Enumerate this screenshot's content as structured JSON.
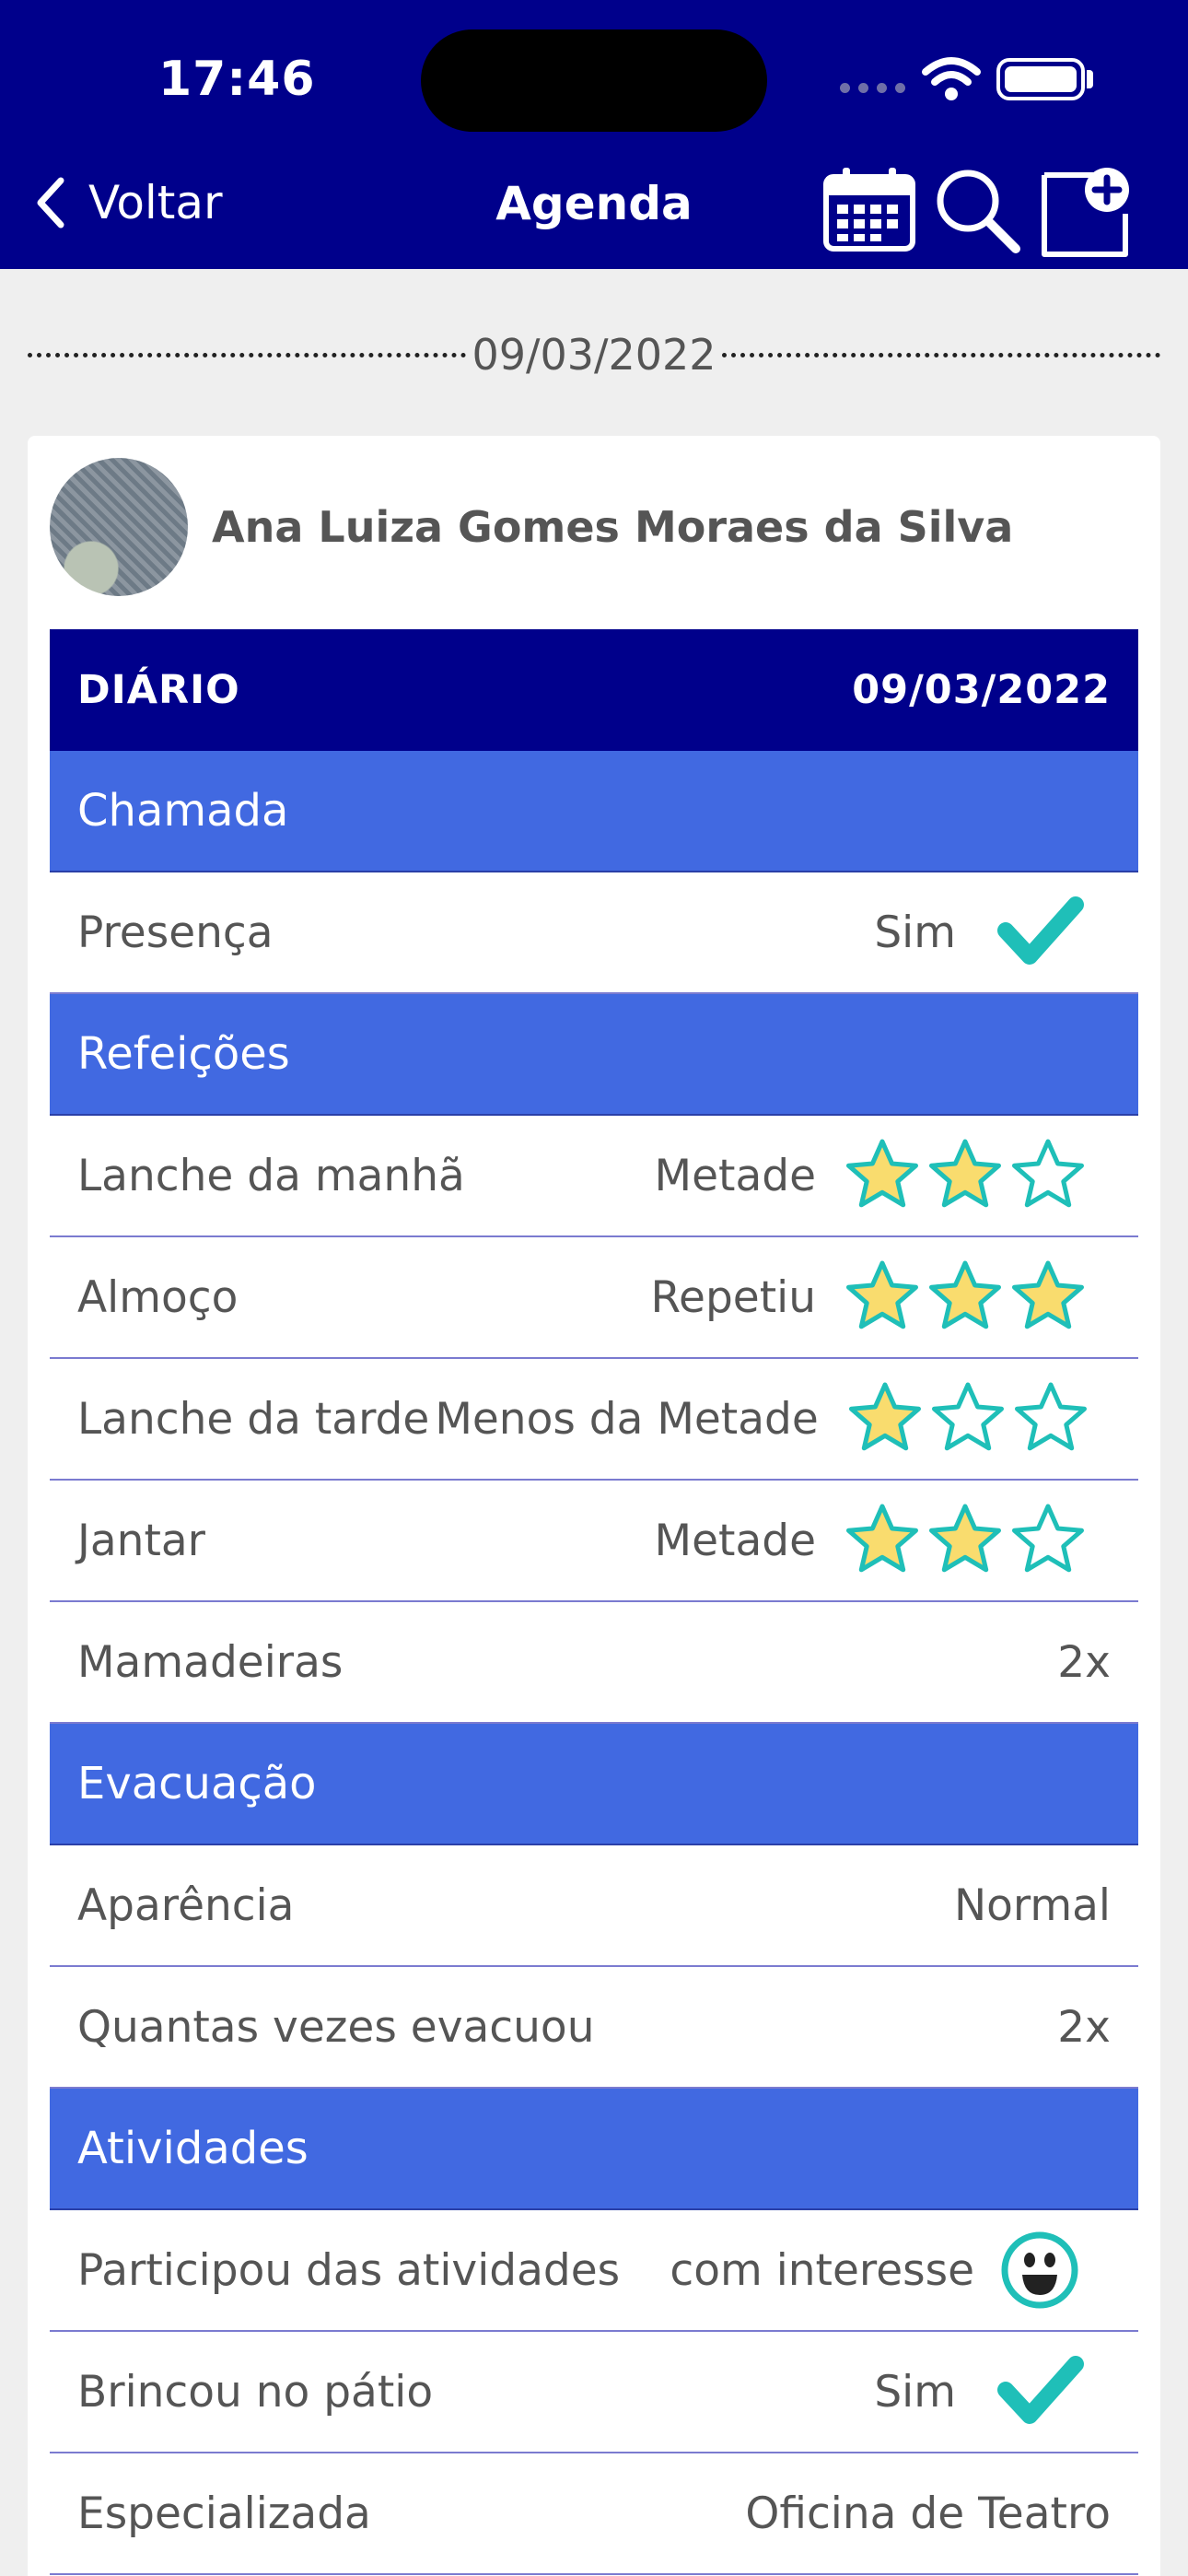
{
  "status_bar": {
    "time": "17:46"
  },
  "nav": {
    "back_label": "Voltar",
    "title": "Agenda",
    "icons": [
      "calendar-icon",
      "search-icon",
      "add-note-icon"
    ]
  },
  "date_divider": "09/03/2022",
  "student": {
    "name": "Ana Luiza Gomes Moraes da Silva"
  },
  "diary": {
    "title": "DIÁRIO",
    "date": "09/03/2022",
    "sections": {
      "chamada": {
        "title": "Chamada",
        "presenca": {
          "label": "Presença",
          "value": "Sim"
        }
      },
      "refeicoes": {
        "title": "Refeições",
        "lanche_manha": {
          "label": "Lanche da manhã",
          "value": "Metade",
          "stars_filled": 2,
          "stars_total": 3
        },
        "almoco": {
          "label": "Almoço",
          "value": "Repetiu",
          "stars_filled": 3,
          "stars_total": 3
        },
        "lanche_tarde": {
          "label": "Lanche da tarde",
          "value": "Menos da Metade",
          "stars_filled": 1,
          "stars_total": 3
        },
        "jantar": {
          "label": "Jantar",
          "value": "Metade",
          "stars_filled": 2,
          "stars_total": 3
        },
        "mamadeiras": {
          "label": "Mamadeiras",
          "value": "2x"
        }
      },
      "evacuacao": {
        "title": "Evacuação",
        "aparencia": {
          "label": "Aparência",
          "value": "Normal"
        },
        "quantas_vezes": {
          "label": "Quantas vezes evacuou",
          "value": "2x"
        }
      },
      "atividades": {
        "title": "Atividades",
        "participou": {
          "label": "Participou das atividades",
          "value": "com interesse"
        },
        "brincou": {
          "label": "Brincou no pátio",
          "value": "Sim"
        },
        "especializada": {
          "label": "Especializada",
          "value": "Oficina de Teatro"
        }
      }
    }
  },
  "colors": {
    "nav_bg": "#00008b",
    "section_bg": "#4169e1",
    "accent_teal": "#1fbfb8",
    "star_fill": "#f9dc6e"
  }
}
